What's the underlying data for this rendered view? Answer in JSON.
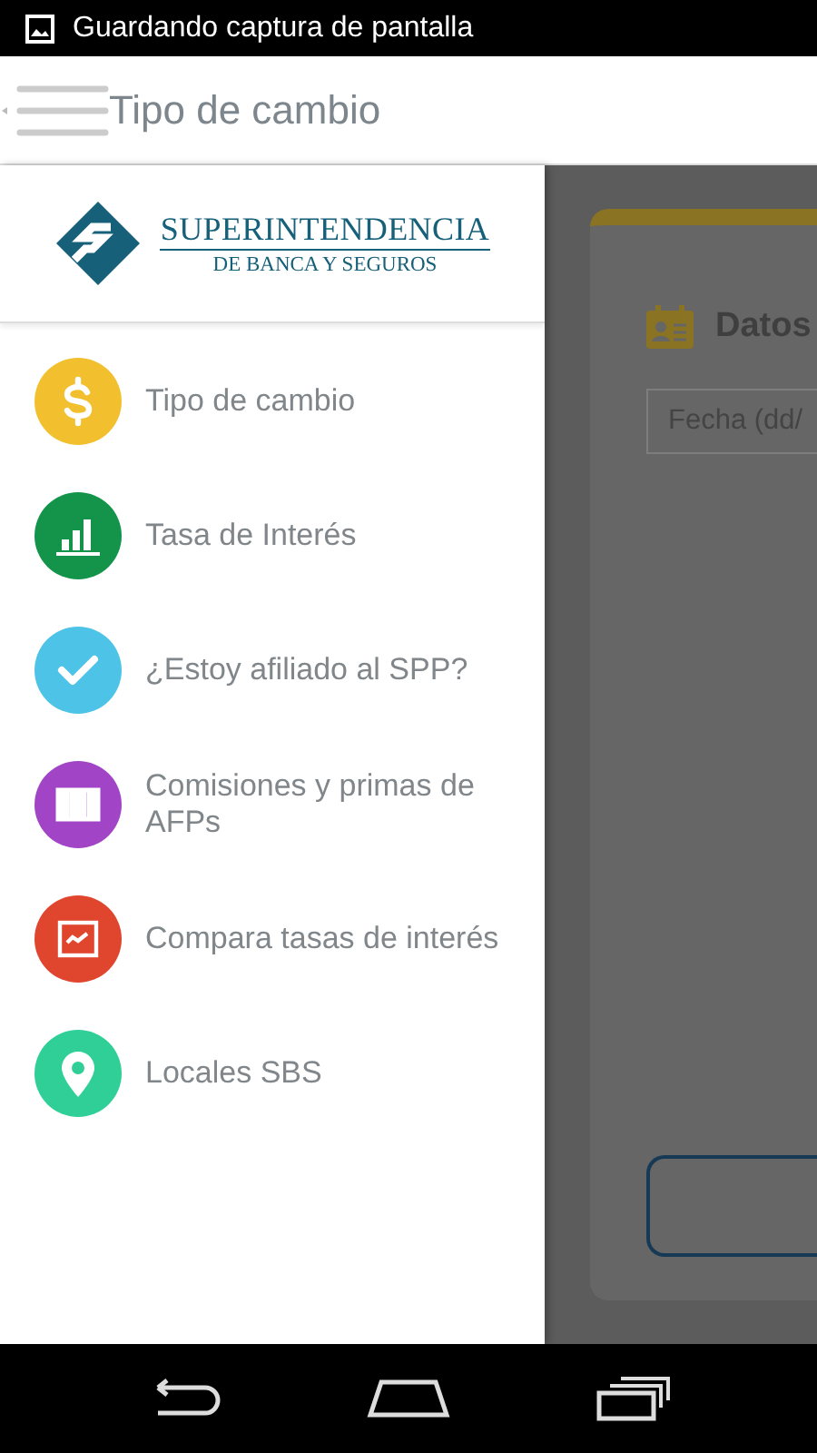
{
  "status_bar": {
    "notification": "Guardando captura de pantalla"
  },
  "app_bar": {
    "title": "Tipo de cambio"
  },
  "drawer": {
    "logo": {
      "line1": "SUPERINTENDENCIA",
      "line2": "DE BANCA Y SEGUROS"
    },
    "items": [
      {
        "label": "Tipo de cambio",
        "kind": "dollar",
        "color": "#f2c02f"
      },
      {
        "label": "Tasa de Interés",
        "kind": "bars",
        "color": "#13944a"
      },
      {
        "label": "¿Estoy afiliado al SPP?",
        "kind": "check",
        "color": "#4ec3e8"
      },
      {
        "label": "Comisiones y primas de AFPs",
        "kind": "columns",
        "color": "#a244c6"
      },
      {
        "label": "Compara tasas de interés",
        "kind": "chart",
        "color": "#e0452d"
      },
      {
        "label": "Locales SBS",
        "kind": "pin",
        "color": "#2fcf97"
      }
    ]
  },
  "background_card": {
    "heading": "Datos",
    "date_field": {
      "placeholder": "Fecha (dd/"
    }
  }
}
